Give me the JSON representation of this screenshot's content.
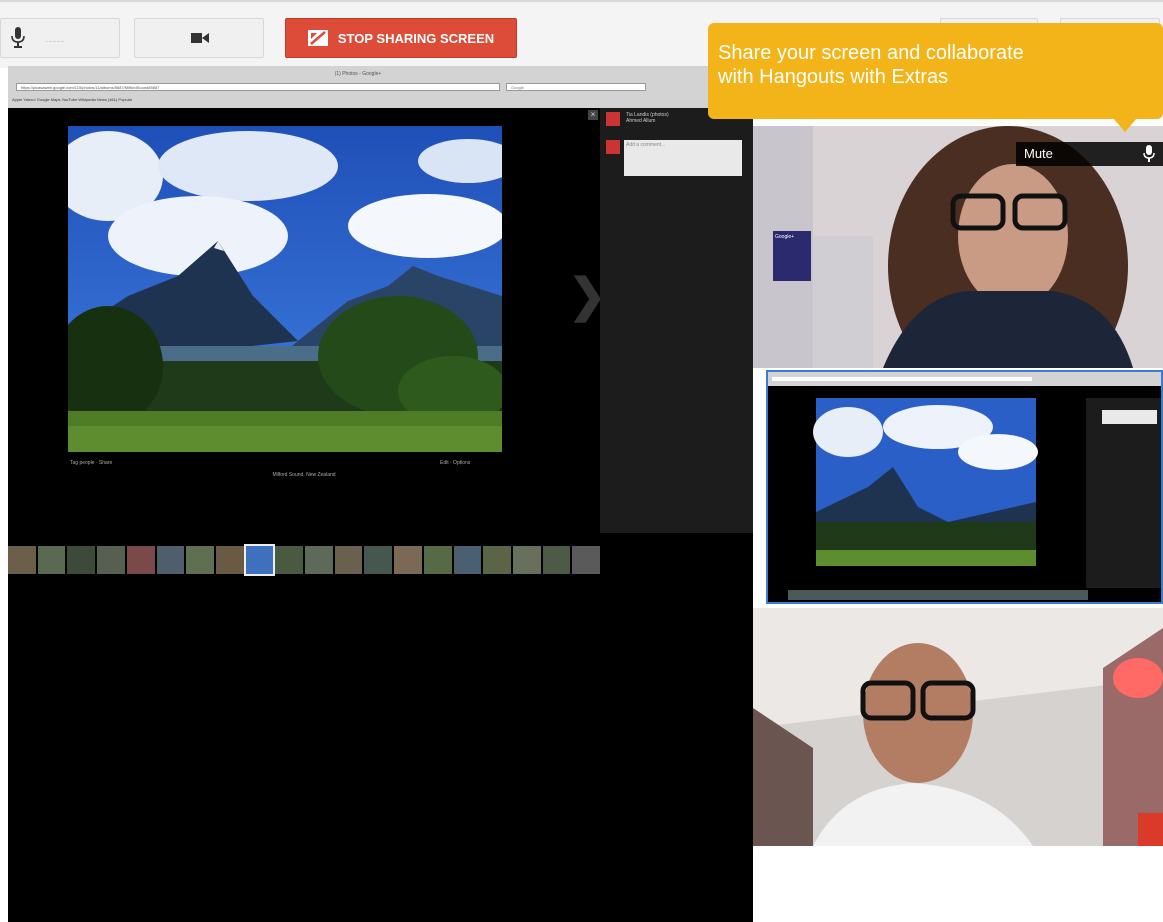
{
  "toolbar": {
    "mic_level": "-----",
    "stop_sharing_label": "STOP SHARING SCREEN"
  },
  "shared_screen": {
    "window_title": "(1) Photos - Google+",
    "address": "https://picasaweb.google.com/115/photos/11/albums/5687/MilfordSound#5687",
    "search_placeholder": "Google",
    "bookmarks": "Apple  Yahoo!  Google Maps  YouTube  Wikipedia  News (461)  Popular",
    "caption_left": "Tag people · Share",
    "caption_right": "Edit · Options",
    "caption_center": "Milford Sound, New Zealand",
    "comments": [
      {
        "author": "Tia Landis (photos)",
        "detail": "Ahmed Allum"
      },
      {
        "author": "",
        "detail": ""
      }
    ],
    "comment_placeholder": "Add a comment..."
  },
  "video": {
    "mute_label": "Mute",
    "poster_label": "Google+"
  },
  "tooltip": {
    "line1": "Share your screen and collaborate",
    "line2": "with Hangouts with Extras"
  },
  "colors": {
    "stop_button": "#dd4b39",
    "tooltip": "#f2b418",
    "selected_video_border": "#3a7bd5"
  }
}
